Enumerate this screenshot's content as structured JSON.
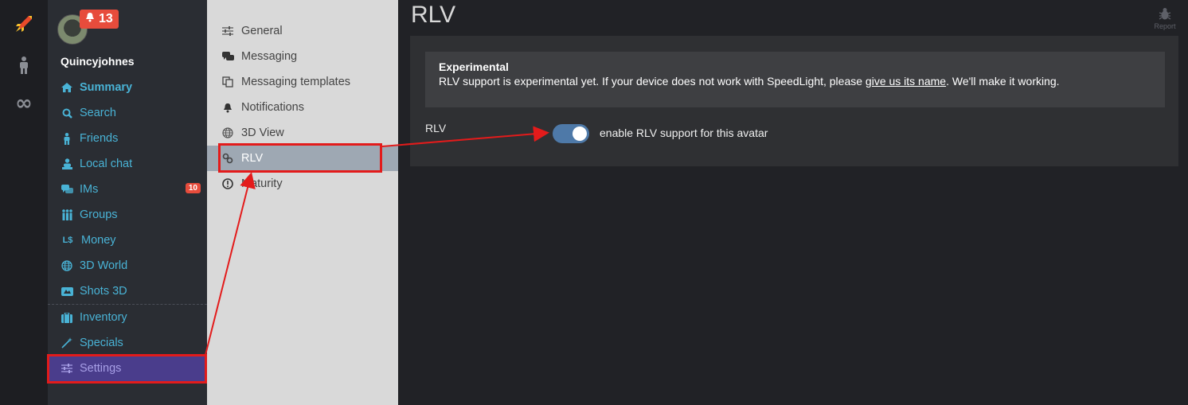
{
  "rail": {
    "items": [
      {
        "icon": "rocket-icon"
      },
      {
        "icon": "person-icon"
      },
      {
        "icon": "infinity-icon",
        "glyph": "∞"
      }
    ]
  },
  "user": {
    "name": "Quincyjohnes",
    "notifications": "13"
  },
  "nav": {
    "items": [
      {
        "label": "Summary",
        "icon": "home-icon"
      },
      {
        "label": "Search",
        "icon": "search-icon"
      },
      {
        "label": "Friends",
        "icon": "friends-icon"
      },
      {
        "label": "Local chat",
        "icon": "local-chat-icon"
      },
      {
        "label": "IMs",
        "icon": "ims-icon",
        "badge": "10"
      },
      {
        "label": "Groups",
        "icon": "groups-icon"
      },
      {
        "label": "Money",
        "icon": "money-icon",
        "glyph": "L$"
      },
      {
        "label": "3D World",
        "icon": "globe-icon"
      },
      {
        "label": "Shots 3D",
        "icon": "shots-icon"
      },
      {
        "label": "Inventory",
        "icon": "inventory-icon"
      },
      {
        "label": "Specials",
        "icon": "wand-icon"
      },
      {
        "label": "Settings",
        "icon": "sliders-icon"
      }
    ]
  },
  "settings_menu": {
    "items": [
      {
        "label": "General",
        "icon": "sliders-icon"
      },
      {
        "label": "Messaging",
        "icon": "messaging-icon"
      },
      {
        "label": "Messaging templates",
        "icon": "templates-icon"
      },
      {
        "label": "Notifications",
        "icon": "bell-icon"
      },
      {
        "label": "3D View",
        "icon": "globe-icon"
      },
      {
        "label": "RLV",
        "icon": "link-icon"
      },
      {
        "label": "Maturity",
        "icon": "warning-icon"
      }
    ]
  },
  "page": {
    "title": "RLV",
    "report_label": "Report"
  },
  "alert": {
    "heading": "Experimental",
    "text_before": "RLV support is experimental yet. If your device does not work with SpeedLight, please ",
    "link": "give us its name",
    "text_after": ". We'll make it working."
  },
  "rlv": {
    "label": "RLV",
    "toggle_label": "enable RLV support for this avatar",
    "enabled": true
  },
  "colors": {
    "accent": "#49b3d6",
    "active_nav": "#4a3d8c",
    "badge": "#e74c3c",
    "toggle": "#4e79a8",
    "annotation": "#e31b1b"
  }
}
